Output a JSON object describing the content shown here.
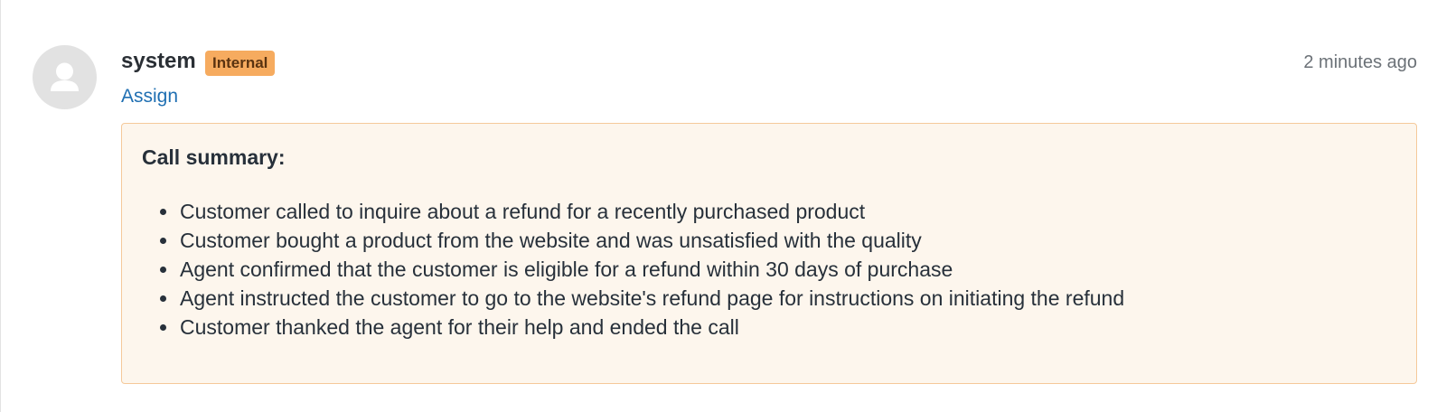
{
  "entry": {
    "author": "system",
    "badge": "Internal",
    "timestamp": "2 minutes ago",
    "assign_label": "Assign",
    "avatar_icon": "user-silhouette-icon"
  },
  "note": {
    "heading": "Call summary:",
    "items": [
      {
        "text": "Customer called to inquire about a refund for a recently purchased product"
      },
      {
        "text": "Customer bought a product from the website and was unsatisfied with the quality"
      },
      {
        "text": "Agent confirmed that the customer is eligible for a refund within 30 days of purchase"
      },
      {
        "text": "Agent instructed the customer to go to the website's refund page for instructions on initiating the refund"
      },
      {
        "text": "Customer thanked the agent for their help and ended the call"
      }
    ]
  },
  "colors": {
    "badge_bg": "#f6ab5f",
    "note_bg": "#fdf6ed",
    "note_border": "#f5c99a",
    "link": "#1f6fb2",
    "avatar_bg": "#e2e2e2"
  }
}
